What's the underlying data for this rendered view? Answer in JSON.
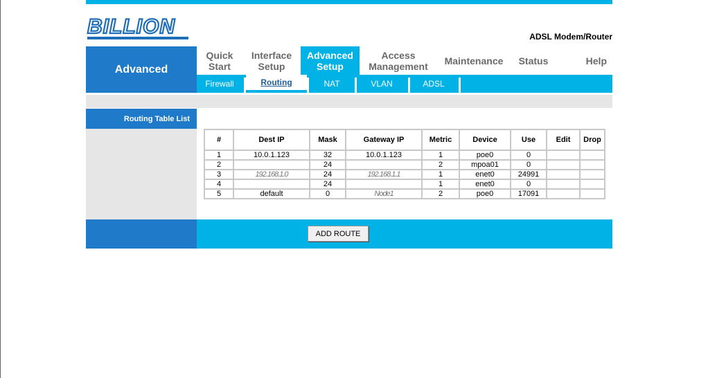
{
  "brand": {
    "logo_text": "BILLION",
    "product": "ADSL Modem/Router"
  },
  "section_title": "Advanced",
  "tabs": [
    {
      "label": "Quick Start",
      "line1": "Quick",
      "line2": "Start",
      "active": false
    },
    {
      "label": "Interface Setup",
      "line1": "Interface",
      "line2": "Setup",
      "active": false
    },
    {
      "label": "Advanced Setup",
      "line1": "Advanced",
      "line2": "Setup",
      "active": true
    },
    {
      "label": "Access Management",
      "line1": "Access",
      "line2": "Management",
      "active": false
    },
    {
      "label": "Maintenance",
      "line1": "Maintenance",
      "line2": "",
      "active": false
    },
    {
      "label": "Status",
      "line1": "Status",
      "line2": "",
      "active": false
    },
    {
      "label": "Help",
      "line1": "Help",
      "line2": "",
      "active": false
    }
  ],
  "subtabs": [
    {
      "label": "Firewall",
      "active": false
    },
    {
      "label": "Routing",
      "active": true
    },
    {
      "label": "NAT",
      "active": false
    },
    {
      "label": "VLAN",
      "active": false
    },
    {
      "label": "ADSL",
      "active": false
    }
  ],
  "routing": {
    "label": "Routing Table List",
    "columns": [
      "#",
      "Dest IP",
      "Mask",
      "Gateway IP",
      "Metric",
      "Device",
      "Use",
      "Edit",
      "Drop"
    ],
    "rows": [
      {
        "num": "1",
        "dest": "10.0.1.123",
        "mask": "32",
        "gateway": "10.0.1.123",
        "metric": "1",
        "device": "poe0",
        "use": "0",
        "edit": "",
        "drop": ""
      },
      {
        "num": "2",
        "dest": "",
        "mask": "24",
        "gateway": "",
        "metric": "2",
        "device": "mpoa01",
        "use": "0",
        "edit": "",
        "drop": ""
      },
      {
        "num": "3",
        "dest": "192.168.1.0",
        "mask": "24",
        "gateway": "192.168.1.1",
        "metric": "1",
        "device": "enet0",
        "use": "24991",
        "edit": "",
        "drop": ""
      },
      {
        "num": "4",
        "dest": "",
        "mask": "24",
        "gateway": "",
        "metric": "1",
        "device": "enet0",
        "use": "0",
        "edit": "",
        "drop": ""
      },
      {
        "num": "5",
        "dest": "default",
        "mask": "0",
        "gateway": "Node1",
        "metric": "2",
        "device": "poe0",
        "use": "17091",
        "edit": "",
        "drop": ""
      }
    ],
    "add_button": "ADD ROUTE"
  },
  "colors": {
    "accent": "#00b2e5",
    "dark_blue": "#1f7ac9",
    "gray": "#e6e6e6"
  }
}
